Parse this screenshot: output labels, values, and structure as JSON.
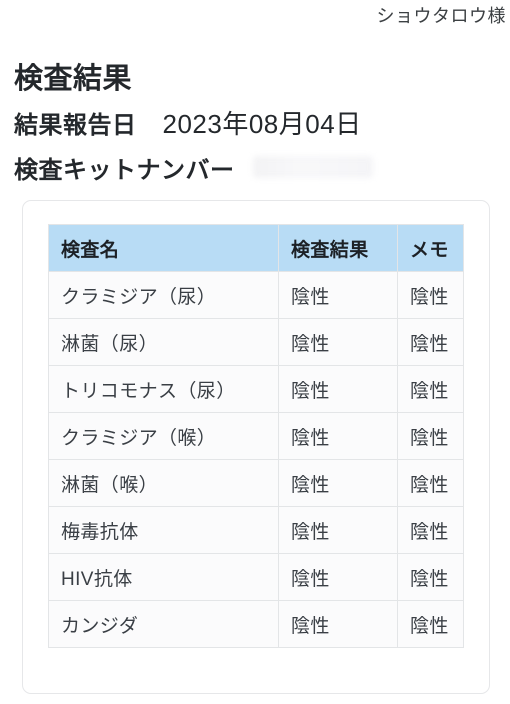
{
  "header": {
    "customer_name": "ショウタロウ様",
    "page_title": "検査結果",
    "report_date_label": "結果報告日",
    "report_date_value": "2023年08月04日",
    "kit_number_label": "検査キットナンバー",
    "kit_number_value": ""
  },
  "table": {
    "columns": [
      "検査名",
      "検査結果",
      "メモ"
    ],
    "rows": [
      {
        "name": "クラミジア（尿）",
        "result": "陰性",
        "memo": "陰性"
      },
      {
        "name": "淋菌（尿）",
        "result": "陰性",
        "memo": "陰性"
      },
      {
        "name": "トリコモナス（尿）",
        "result": "陰性",
        "memo": "陰性"
      },
      {
        "name": "クラミジア（喉）",
        "result": "陰性",
        "memo": "陰性"
      },
      {
        "name": "淋菌（喉）",
        "result": "陰性",
        "memo": "陰性"
      },
      {
        "name": "梅毒抗体",
        "result": "陰性",
        "memo": "陰性"
      },
      {
        "name": "HIV抗体",
        "result": "陰性",
        "memo": "陰性"
      },
      {
        "name": "カンジダ",
        "result": "陰性",
        "memo": "陰性"
      }
    ]
  },
  "colors": {
    "table_header_bg": "#b8dcf5",
    "card_border": "#e6e7e9",
    "cell_border": "#e3e5e7",
    "text_primary": "#24282c",
    "text_cell": "#3a3f45",
    "page_bg": "#ffffff"
  }
}
